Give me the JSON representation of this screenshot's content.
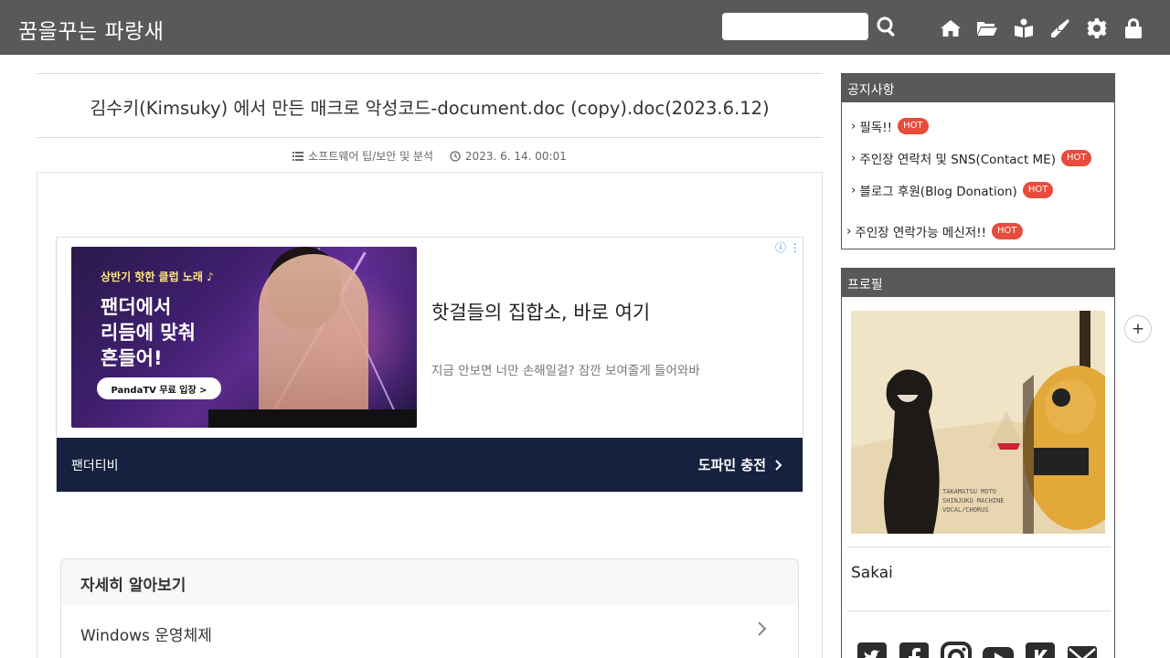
{
  "header": {
    "site_title": "꿈을꾸는 파랑새",
    "search_placeholder": "",
    "icons": [
      "search-icon",
      "home-icon",
      "folder-open-icon",
      "guestbook-icon",
      "write-icon",
      "gear-icon",
      "lock-icon"
    ]
  },
  "post": {
    "title": "김수키(Kimsuky) 에서 만든 매크로 악성코드-document.doc (copy).doc(2023.6.12)",
    "category": "소프트웨어 팁/보안 및 분석",
    "date": "2023. 6. 14. 00:01"
  },
  "ad": {
    "image_small_text": "상반기 핫한 클럽 노래 ♪",
    "image_big_line1": "팬더에서",
    "image_big_line2": "리듬에 맞춰",
    "image_big_line3": "흔들어!",
    "image_pill": "PandaTV 무료 입장 >",
    "headline": "핫걸들의 집합소, 바로 여기",
    "description": "지금 안보면 너만 손해일걸? 잠깐 보여줄게 들어와바",
    "brand": "팬더티비",
    "cta": "도파민 충전"
  },
  "learn_more": {
    "title": "자세히 알아보기",
    "items": [
      "Windows 운영체제"
    ]
  },
  "sidebar": {
    "notice": {
      "title": "공지사항",
      "items": [
        {
          "label": "필독!!",
          "badge": "HOT"
        },
        {
          "label": "주인장 연락처 및 SNS(Contact ME)",
          "badge": "HOT"
        },
        {
          "label": "블로그 후원(Blog Donation)",
          "badge": "HOT"
        },
        {
          "label": "주인장 연락가능 메신저!!",
          "badge": "HOT"
        }
      ]
    },
    "profile": {
      "title": "프로필",
      "name": "Sakai",
      "social_icons": [
        "twitter-icon",
        "facebook-icon",
        "instagram-icon",
        "youtube-icon",
        "kakao-icon",
        "mail-icon"
      ]
    }
  },
  "floating": {
    "plus": "+"
  },
  "colors": {
    "header_bg": "#595959",
    "ad_footer_bg": "#16213f",
    "hot_badge": "#e74c3c"
  }
}
